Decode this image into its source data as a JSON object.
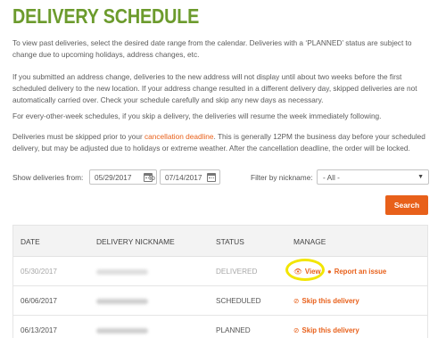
{
  "page": {
    "title": "DELIVERY SCHEDULE"
  },
  "intro": {
    "p1": "To view past deliveries, select the desired date range from the calendar. Deliveries with a ‘PLANNED’ status are subject to change due to upcoming holidays, address changes, etc.",
    "p2": "If you submitted an address change, deliveries to the new address will not display until about two weeks before the first scheduled delivery to the new location. If your address change resulted in a different delivery day, skipped deliveries are not automatically carried over. Check your schedule carefully and skip any new days as necessary.",
    "p3": "For every-other-week schedules, if you skip a delivery, the deliveries will resume the week immediately following.",
    "p4_before": "Deliveries must be skipped prior to your ",
    "p4_link": "cancellation deadline",
    "p4_after": ". This is generally 12PM the business day before your scheduled delivery, but may be adjusted due to holidays or extreme weather. After the cancellation deadline, the order will be locked."
  },
  "filters": {
    "show_label": "Show deliveries from:",
    "from_date": "05/29/2017",
    "to_label": "to",
    "to_date": "07/14/2017",
    "nickname_label": "Filter by nickname:",
    "nickname_value": "- All -",
    "search_label": "Search"
  },
  "table": {
    "headers": {
      "date": "DATE",
      "nickname": "DELIVERY NICKNAME",
      "status": "STATUS",
      "manage": "MANAGE"
    },
    "rows": [
      {
        "date": "05/30/2017",
        "status": "DELIVERED",
        "action1": "View",
        "action2": "Report an issue"
      },
      {
        "date": "06/06/2017",
        "status": "SCHEDULED",
        "action1": "Skip this delivery"
      },
      {
        "date": "06/13/2017",
        "status": "PLANNED",
        "action1": "Skip this delivery"
      }
    ]
  },
  "colors": {
    "title_green": "#6c9b2d",
    "accent_orange": "#e8601a",
    "highlight_yellow": "#f2e500"
  }
}
